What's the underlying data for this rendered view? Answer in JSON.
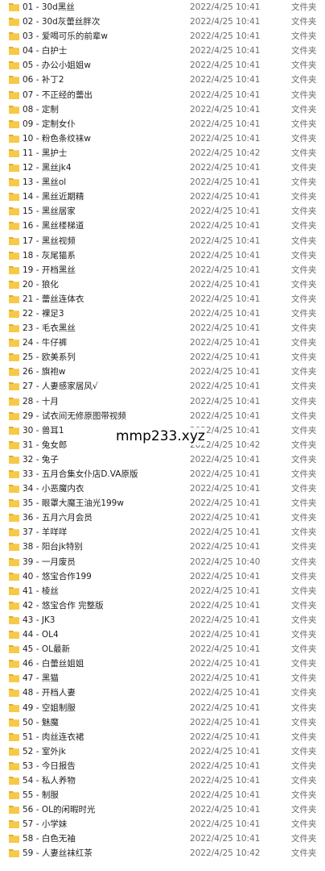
{
  "file_list": {
    "items": [
      {
        "name": "01 - 30d黑丝",
        "date": "2022/4/25 10:41",
        "type": "文件夹"
      },
      {
        "name": "02 - 30d灰蕾丝胖次",
        "date": "2022/4/25 10:41",
        "type": "文件夹"
      },
      {
        "name": "03 - 爱喝可乐的前辈w",
        "date": "2022/4/25 10:41",
        "type": "文件夹"
      },
      {
        "name": "04 - 白护士",
        "date": "2022/4/25 10:41",
        "type": "文件夹"
      },
      {
        "name": "05 - 办公小姐姐w",
        "date": "2022/4/25 10:41",
        "type": "文件夹"
      },
      {
        "name": "06 - 补丁2",
        "date": "2022/4/25 10:41",
        "type": "文件夹"
      },
      {
        "name": "07 - 不正经的蕾出",
        "date": "2022/4/25 10:41",
        "type": "文件夹"
      },
      {
        "name": "08 - 定制",
        "date": "2022/4/25 10:41",
        "type": "文件夹"
      },
      {
        "name": "09 - 定制女仆",
        "date": "2022/4/25 10:41",
        "type": "文件夹"
      },
      {
        "name": "10 - 粉色条纹袜w",
        "date": "2022/4/25 10:41",
        "type": "文件夹"
      },
      {
        "name": "11 - 黑护士",
        "date": "2022/4/25 10:42",
        "type": "文件夹"
      },
      {
        "name": "12 - 黑丝jk4",
        "date": "2022/4/25 10:41",
        "type": "文件夹"
      },
      {
        "name": "13 - 黑丝ol",
        "date": "2022/4/25 10:41",
        "type": "文件夹"
      },
      {
        "name": "14 - 黑丝近期精",
        "date": "2022/4/25 10:41",
        "type": "文件夹"
      },
      {
        "name": "15 - 黑丝居家",
        "date": "2022/4/25 10:41",
        "type": "文件夹"
      },
      {
        "name": "16 - 黑丝楼梯道",
        "date": "2022/4/25 10:41",
        "type": "文件夹"
      },
      {
        "name": "17 - 黑丝视频",
        "date": "2022/4/25 10:41",
        "type": "文件夹"
      },
      {
        "name": "18 - 灰尾猫系",
        "date": "2022/4/25 10:41",
        "type": "文件夹"
      },
      {
        "name": "19 - 开档黑丝",
        "date": "2022/4/25 10:41",
        "type": "文件夹"
      },
      {
        "name": "20 - 狼化",
        "date": "2022/4/25 10:41",
        "type": "文件夹"
      },
      {
        "name": "21 - 蕾丝连体衣",
        "date": "2022/4/25 10:41",
        "type": "文件夹"
      },
      {
        "name": "22 - 裸足3",
        "date": "2022/4/25 10:41",
        "type": "文件夹"
      },
      {
        "name": "23 - 毛衣黑丝",
        "date": "2022/4/25 10:41",
        "type": "文件夹"
      },
      {
        "name": "24 - 牛仔裤",
        "date": "2022/4/25 10:41",
        "type": "文件夹"
      },
      {
        "name": "25 - 欧美系列",
        "date": "2022/4/25 10:41",
        "type": "文件夹"
      },
      {
        "name": "26 - 旗袍w",
        "date": "2022/4/25 10:41",
        "type": "文件夹"
      },
      {
        "name": "27 - 人妻感家居风√",
        "date": "2022/4/25 10:41",
        "type": "文件夹"
      },
      {
        "name": "28 - 十月",
        "date": "2022/4/25 10:41",
        "type": "文件夹"
      },
      {
        "name": "29 - 试衣间无修原图带视频",
        "date": "2022/4/25 10:41",
        "type": "文件夹"
      },
      {
        "name": "30 - 兽耳1",
        "date": "2022/4/25 10:41",
        "type": "文件夹"
      },
      {
        "name": "31 - 兔女郎",
        "date": "2022/4/25 10:42",
        "type": "文件夹"
      },
      {
        "name": "32 - 兔子",
        "date": "2022/4/25 10:41",
        "type": "文件夹"
      },
      {
        "name": "33 - 五月合集女仆店D.VA原版",
        "date": "2022/4/25 10:41",
        "type": "文件夹"
      },
      {
        "name": "34 - 小恶魔内衣",
        "date": "2022/4/25 10:41",
        "type": "文件夹"
      },
      {
        "name": "35 - 眼罩大魔王油光199w",
        "date": "2022/4/25 10:41",
        "type": "文件夹"
      },
      {
        "name": "36 - 五月六月会员",
        "date": "2022/4/25 10:41",
        "type": "文件夹"
      },
      {
        "name": "37 - 羊咩咩",
        "date": "2022/4/25 10:41",
        "type": "文件夹"
      },
      {
        "name": "38 - 阳台jk特别",
        "date": "2022/4/25 10:41",
        "type": "文件夹"
      },
      {
        "name": "39 - 一月废员",
        "date": "2022/4/25 10:40",
        "type": "文件夹"
      },
      {
        "name": "40 - 悠宝合作199",
        "date": "2022/4/25 10:41",
        "type": "文件夹"
      },
      {
        "name": "41 - 棱丝",
        "date": "2022/4/25 10:41",
        "type": "文件夹"
      },
      {
        "name": "42 - 悠宝合作 完整版",
        "date": "2022/4/25 10:41",
        "type": "文件夹"
      },
      {
        "name": "43 - JK3",
        "date": "2022/4/25 10:41",
        "type": "文件夹"
      },
      {
        "name": "44 - OL4",
        "date": "2022/4/25 10:41",
        "type": "文件夹"
      },
      {
        "name": "45 - OL最新",
        "date": "2022/4/25 10:41",
        "type": "文件夹"
      },
      {
        "name": "46 - 白蕾丝姐姐",
        "date": "2022/4/25 10:41",
        "type": "文件夹"
      },
      {
        "name": "47 - 黑猫",
        "date": "2022/4/25 10:41",
        "type": "文件夹"
      },
      {
        "name": "48 - 开档人妻",
        "date": "2022/4/25 10:41",
        "type": "文件夹"
      },
      {
        "name": "49 - 空姐制服",
        "date": "2022/4/25 10:41",
        "type": "文件夹"
      },
      {
        "name": "50 - 魅魔",
        "date": "2022/4/25 10:41",
        "type": "文件夹"
      },
      {
        "name": "51 - 肉丝连衣裙",
        "date": "2022/4/25 10:41",
        "type": "文件夹"
      },
      {
        "name": "52 - 室外jk",
        "date": "2022/4/25 10:41",
        "type": "文件夹"
      },
      {
        "name": "53 - 今日报告",
        "date": "2022/4/25 10:41",
        "type": "文件夹"
      },
      {
        "name": "54 - 私人养物",
        "date": "2022/4/25 10:41",
        "type": "文件夹"
      },
      {
        "name": "55 - 制服",
        "date": "2022/4/25 10:41",
        "type": "文件夹"
      },
      {
        "name": "56 - OL的闲暇时光",
        "date": "2022/4/25 10:41",
        "type": "文件夹"
      },
      {
        "name": "57 - 小学妹",
        "date": "2022/4/25 10:41",
        "type": "文件夹"
      },
      {
        "name": "58 -  白色无袖",
        "date": "2022/4/25 10:41",
        "type": "文件夹"
      },
      {
        "name": "59 - 人妻丝袜红茶",
        "date": "2022/4/25 10:42",
        "type": "文件夹"
      }
    ]
  },
  "watermark": {
    "text": "mmp233.xyz"
  },
  "colors": {
    "folder": "#f7c948",
    "folder_tab": "#e3ad2b",
    "name_text": "#1e1e1e",
    "meta_text": "#6d6d6d"
  },
  "icons": {
    "folder": "folder-icon"
  }
}
